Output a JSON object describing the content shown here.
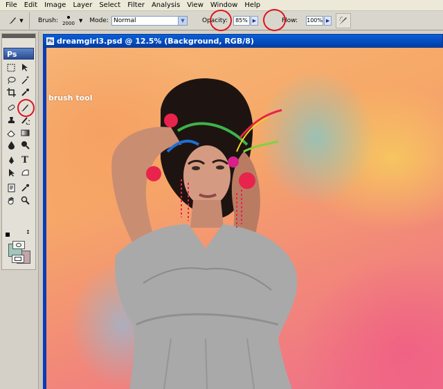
{
  "menubar": {
    "items": [
      "File",
      "Edit",
      "Image",
      "Layer",
      "Select",
      "Filter",
      "Analysis",
      "View",
      "Window",
      "Help"
    ]
  },
  "options": {
    "brush_label": "Brush:",
    "brush_size": "2000",
    "mode_label": "Mode:",
    "mode_value": "Normal",
    "opacity_label": "Opacity:",
    "opacity_value": "85%",
    "flow_label": "Flow:",
    "flow_value": "100%"
  },
  "toolbox": {
    "logo": "Ps",
    "foreground_color": "#9ec8bb",
    "background_color": "#c2a5ab",
    "tools": [
      "rectangular-marquee-tool",
      "move-tool",
      "lasso-tool",
      "magic-wand-tool",
      "crop-tool",
      "eyedropper-tool",
      "healing-brush-tool",
      "brush-tool",
      "clone-stamp-tool",
      "history-brush-tool",
      "eraser-tool",
      "gradient-tool",
      "blur-tool",
      "dodge-tool",
      "pen-tool",
      "type-tool",
      "path-selection-tool",
      "shape-tool",
      "notes-tool",
      "eyedropper-tool-2",
      "hand-tool",
      "zoom-tool"
    ]
  },
  "document": {
    "title": "dreamgirl3.psd @ 12.5% (Background, RGB/8)",
    "canvas_label": "brush tool"
  },
  "colors": {
    "highlight_circle": "#e0141a",
    "title_bar": "#0a5fd8"
  }
}
